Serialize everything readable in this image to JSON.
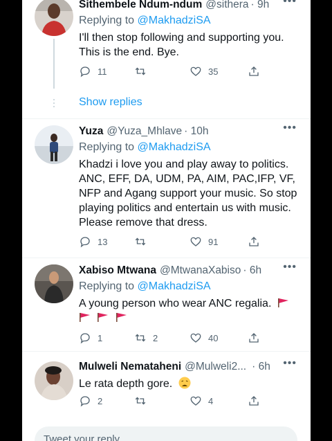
{
  "composer": {
    "placeholder": "Tweet your reply"
  },
  "tweets": [
    {
      "name": "Sithembele Ndum-ndum",
      "handle": "@sithera",
      "time": "· 9h",
      "replying_label": "Replying to",
      "replying_to": "@MakhadziSA",
      "text": "I'll then stop following and supporting you. This is the end. Bye.",
      "replies": "11",
      "retweets": "",
      "likes": "35"
    },
    {
      "name": "Yuza",
      "handle": "@Yuza_Mhlave",
      "time": "· 10h",
      "replying_label": "Replying to",
      "replying_to": "@MakhadziSA",
      "text": "Khadzi i love you and play away to politics. ANC, EFF, DA, UDM, PA, AIM, PAC,IFP, VF, NFP and Agang support your music. So stop playing politics and entertain us with music. Please remove that dress.",
      "replies": "13",
      "retweets": "",
      "likes": "91"
    },
    {
      "name": "Xabiso Mtwana",
      "handle": "@MtwanaXabiso",
      "time": "· 6h",
      "replying_label": "Replying to",
      "replying_to": "@MakhadziSA",
      "text": "A young person who wear ANC regalia.",
      "replies": "1",
      "retweets": "2",
      "likes": "40"
    },
    {
      "name": "Mulweli Nemataheni",
      "handle": "@Mulweli2...",
      "time": "· 6h",
      "text": "Le rata depth gore.",
      "replies": "2",
      "retweets": "",
      "likes": "4"
    }
  ],
  "show_replies": "Show replies",
  "colors": {
    "accent": "#1d9bf0",
    "secondary_text": "#536471",
    "flag": "#e0245e"
  }
}
